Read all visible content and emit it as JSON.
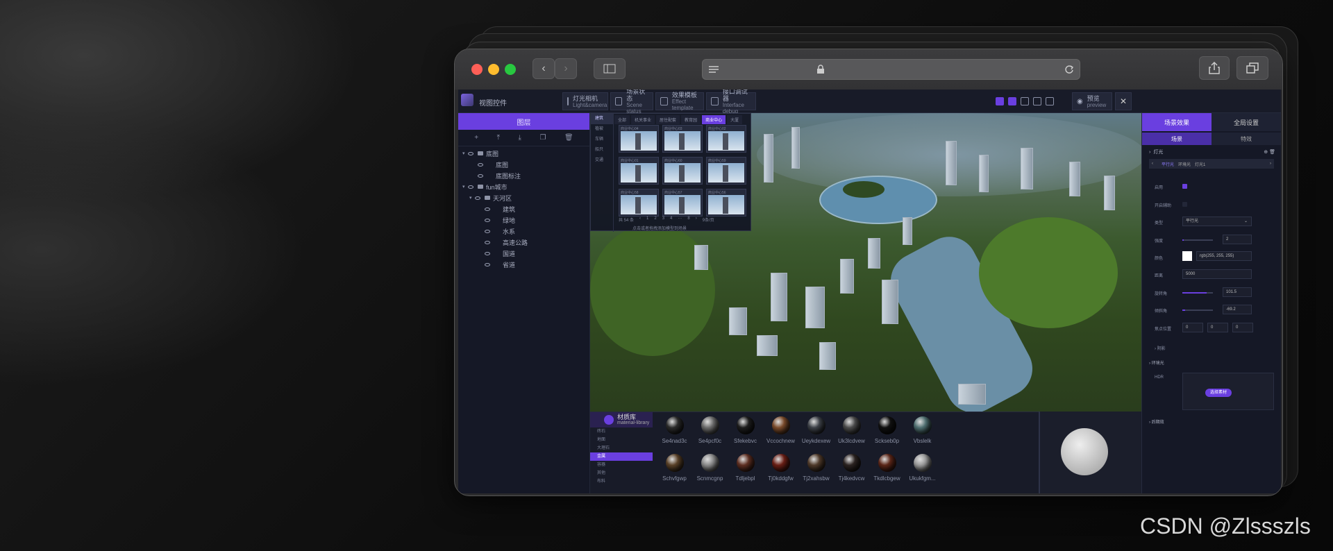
{
  "app": {
    "title": "视图控件",
    "modules": [
      {
        "l1": "灯光相机",
        "l2": "Light&camera"
      },
      {
        "l1": "场景状态",
        "l2": "Scene status"
      },
      {
        "l1": "效果模板",
        "l2": "Effect template"
      },
      {
        "l1": "接口调试器",
        "l2": "Interface debug"
      }
    ],
    "preview": {
      "l1": "预览",
      "l2": "preview"
    }
  },
  "layers": {
    "header": "图层",
    "items": [
      "底图",
      "底图",
      "底图标注",
      "fun城市",
      "天河区",
      "建筑",
      "绿地",
      "水系",
      "高速公路",
      "国道",
      "省道"
    ]
  },
  "model_lib": {
    "cats": [
      "建筑",
      "植被",
      "车辆",
      "船只",
      "交通"
    ],
    "tabs": [
      "全部",
      "机关事业",
      "居住配套",
      "教育园",
      "商业中心",
      "大厦"
    ],
    "cards": [
      "商业中心04",
      "商业中心03",
      "商业中心02",
      "商业中心01",
      "商业中心60",
      "商业中心59",
      "商业中心58",
      "商业中心57",
      "商业中心56"
    ],
    "pager": {
      "total": "共 54 条",
      "pages": [
        "1",
        "2",
        "3",
        "4",
        "···",
        "8"
      ],
      "size": "9条/页"
    },
    "hint": "点击或者拖拽添加模型到场景"
  },
  "material_lib": {
    "title": "材质库",
    "subtitle": "material-library",
    "cats": [
      "砖石",
      "地面",
      "大理石",
      "金属",
      "容器",
      "其他",
      "布料"
    ],
    "active_cat": "金属",
    "materials": [
      {
        "name": "Se4nad3c",
        "color": "#2a2a2a"
      },
      {
        "name": "Se4pcf0c",
        "color": "#6b6b6b"
      },
      {
        "name": "Sfekebvc",
        "color": "#1d1d1d"
      },
      {
        "name": "Vccochnew",
        "color": "#7a4a2a"
      },
      {
        "name": "Ueykdexew",
        "color": "#3c4047"
      },
      {
        "name": "Uk3lcdvew",
        "color": "#4a4a4a"
      },
      {
        "name": "Sckseb0p",
        "color": "#111111"
      },
      {
        "name": "Vbslelk",
        "color": "#4e6e70"
      },
      {
        "name": "Schvfgwp",
        "color": "#5a4128"
      },
      {
        "name": "Scnmcgnp",
        "color": "#8a8a8a"
      },
      {
        "name": "Tdljebpl",
        "color": "#5e2f22"
      },
      {
        "name": "Tj0kddgfw",
        "color": "#6a1f16"
      },
      {
        "name": "Tj2xahsbw",
        "color": "#4f3a2a"
      },
      {
        "name": "Tj4kedvcw",
        "color": "#2b2321"
      },
      {
        "name": "Tkdlcbgew",
        "color": "#5b2618"
      },
      {
        "name": "Ukukfgm...",
        "color": "#9a9a9a"
      }
    ]
  },
  "panel": {
    "tabs": [
      "场景效果",
      "全局设置"
    ],
    "subtabs": [
      "场景",
      "特效"
    ],
    "light_section": "灯光",
    "light_nav": [
      "平行光",
      "环境光",
      "灯光1"
    ],
    "props": {
      "enable": "启用",
      "assist": "开启辅助",
      "type_label": "类型",
      "type_value": "平行光",
      "intensity_label": "强度",
      "intensity_value": "2",
      "intensity_level": 0.05,
      "color_label": "颜色",
      "color_value": "rgb(255, 255, 255)",
      "distance_label": "距离",
      "distance_value": "5000",
      "rot_label": "旋转角",
      "rot_value": "101.5",
      "rot_level": 0.8,
      "tilt_label": "倾斜角",
      "tilt_value": "-69.2",
      "tilt_level": 0.08,
      "focus_label": "焦点位置",
      "focus_values": [
        "0",
        "0",
        "0"
      ],
      "shadow": "阴影"
    },
    "env_section": "环境光",
    "hdr_label": "HDR",
    "hdr_button": "选择素材",
    "bottom_section": "后期效"
  },
  "watermark": "CSDN @Zlssszls",
  "colors": {
    "accent": "#6a3fe0"
  }
}
